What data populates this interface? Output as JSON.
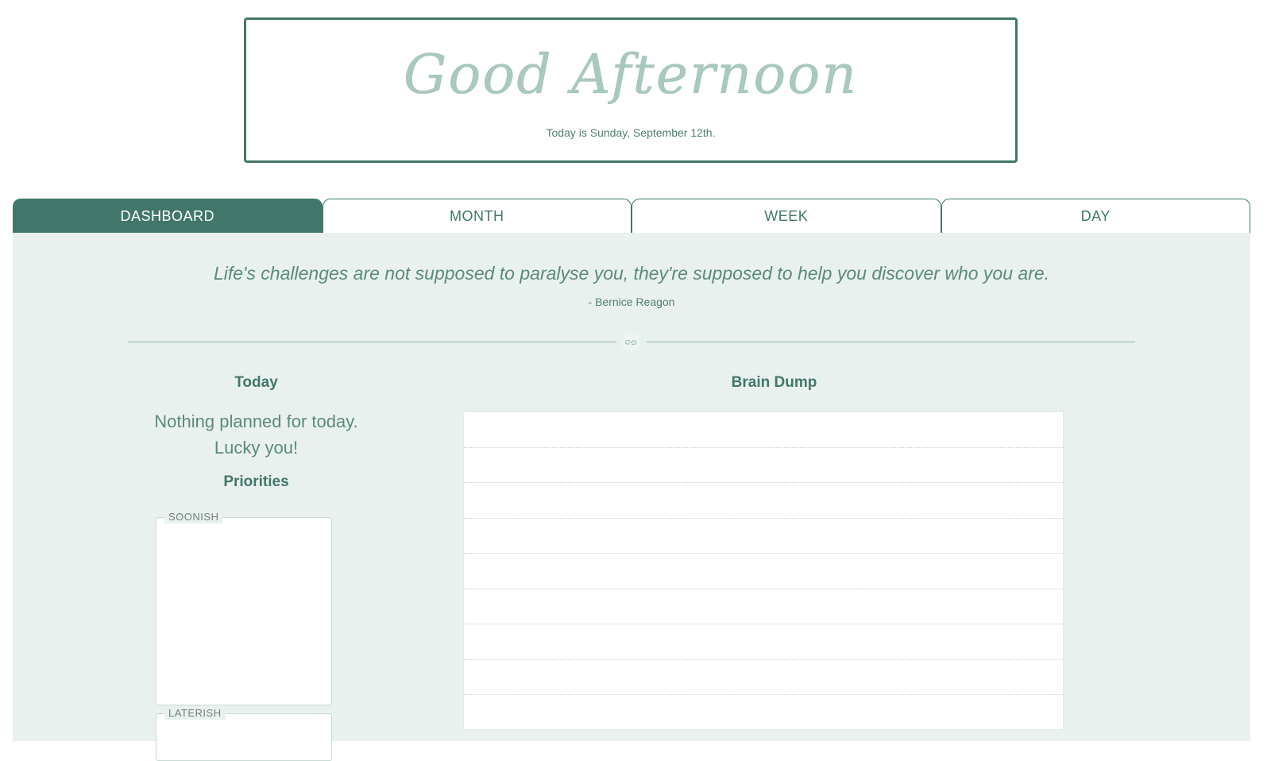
{
  "greeting": {
    "title": "Good Afternoon",
    "date_text": "Today is Sunday, September 12th."
  },
  "tabs": [
    {
      "label": "DASHBOARD",
      "active": true
    },
    {
      "label": "MONTH",
      "active": false
    },
    {
      "label": "WEEK",
      "active": false
    },
    {
      "label": "DAY",
      "active": false
    }
  ],
  "quote": {
    "text": "Life's challenges are not supposed to paralyse you, they're supposed to help you discover who you are.",
    "author": "- Bernice Reagon"
  },
  "divider": {
    "icon": "link-icon"
  },
  "today": {
    "title": "Today",
    "empty_line1": "Nothing planned for today.",
    "empty_line2": "Lucky you!"
  },
  "priorities": {
    "title": "Priorities",
    "soonish_label": "SOONISH",
    "laterish_label": "LATERISH"
  },
  "brain_dump": {
    "title": "Brain Dump",
    "line_count": 9
  },
  "colors": {
    "accent": "#41776a",
    "panel_bg": "#e9f1ee",
    "greeting_script": "#a9c8bf"
  }
}
